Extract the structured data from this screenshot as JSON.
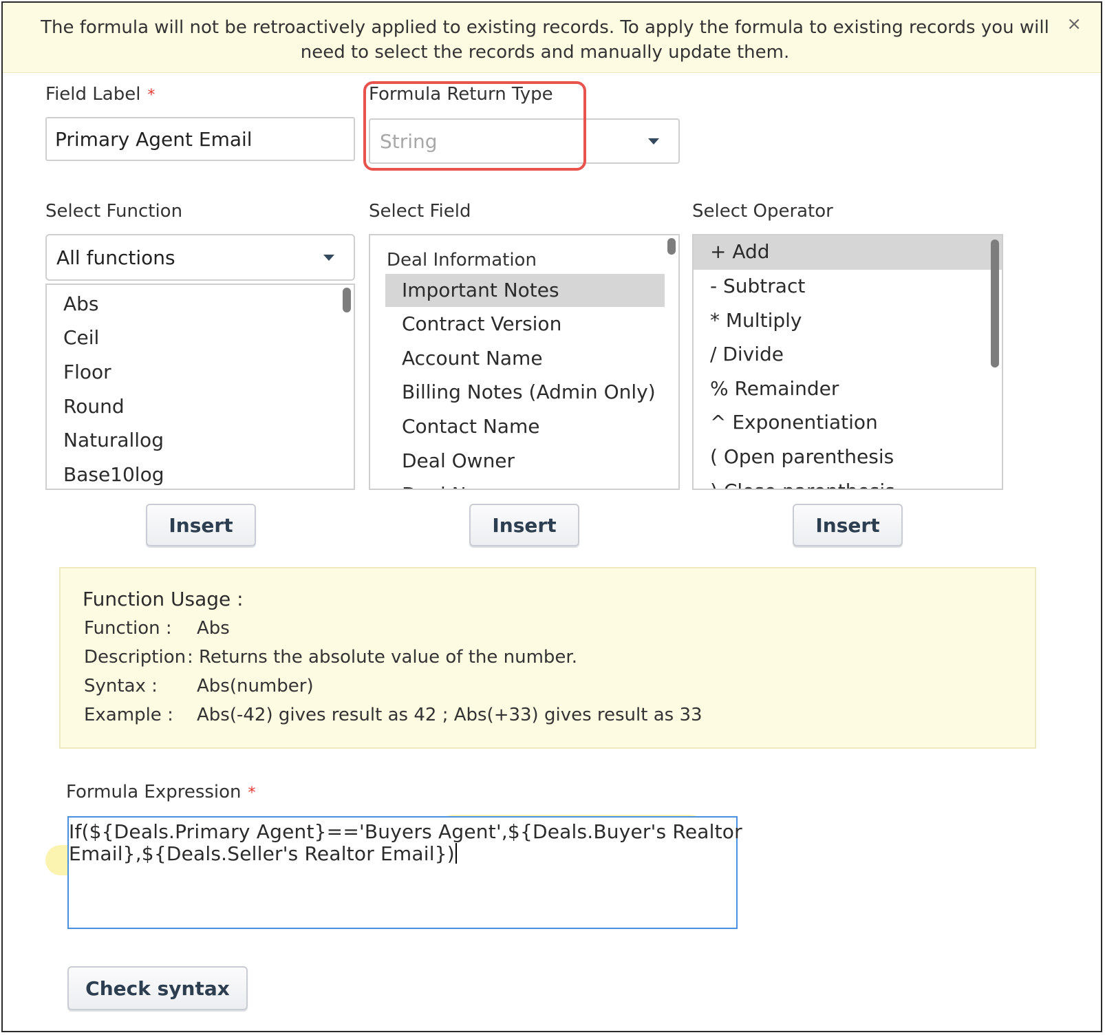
{
  "banner": {
    "message": "The formula will not be retroactively applied to existing records. To apply the formula to existing records you will need to select the records and manually update them.",
    "close_glyph": "×"
  },
  "field_label": {
    "label": "Field Label",
    "required_mark": "*",
    "value": "Primary Agent Email"
  },
  "return_type": {
    "label": "Formula Return Type",
    "value": "String"
  },
  "select_function": {
    "label": "Select Function",
    "dropdown_value": "All functions",
    "items": [
      "Abs",
      "Ceil",
      "Floor",
      "Round",
      "Naturallog",
      "Base10log"
    ],
    "insert_label": "Insert"
  },
  "select_field": {
    "label": "Select Field",
    "group": "Deal Information",
    "items": [
      "Important Notes",
      "Contract Version",
      "Account Name",
      "Billing Notes (Admin Only)",
      "Contact Name",
      "Deal Owner",
      "Deal Name"
    ],
    "selected_index": 0,
    "insert_label": "Insert"
  },
  "select_operator": {
    "label": "Select Operator",
    "items": [
      "+ Add",
      "- Subtract",
      "* Multiply",
      "/ Divide",
      "% Remainder",
      "^ Exponentiation",
      "( Open parenthesis",
      ") Close parenthesis"
    ],
    "selected_index": 0,
    "insert_label": "Insert"
  },
  "function_usage": {
    "title": "Function Usage :",
    "rows": [
      {
        "key": "Function :",
        "value": "Abs"
      },
      {
        "key": "Description",
        "value": ": Returns the absolute value of the number."
      },
      {
        "key": "Syntax :",
        "value": "Abs(number)"
      },
      {
        "key": "Example :",
        "value": "Abs(-42) gives result as 42 ; Abs(+33) gives result as 33"
      }
    ]
  },
  "formula_expression": {
    "label": "Formula Expression",
    "required_mark": "*",
    "line1_plain": "If(${Deals.Primary Agent}=='Buyers Agent",
    "line1_highlight": "',${Deals.Buyer's Realtor",
    "line2": "Email},${Deals.Seller's Realtor Email})"
  },
  "check_syntax_label": "Check syntax",
  "colors": {
    "banner_bg": "#fdfbe2",
    "highlight_red": "#e9534e",
    "focus_blue": "#4a90e2",
    "marker_yellow": "#fbf3a8"
  }
}
